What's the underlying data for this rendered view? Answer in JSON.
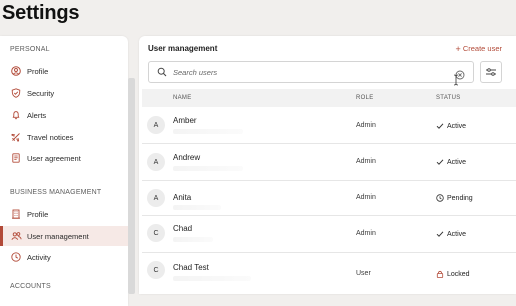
{
  "page": {
    "title": "Settings"
  },
  "sidebar": {
    "personal_heading": "PERSONAL",
    "personal_items": [
      {
        "label": "Profile",
        "icon": "user-circle-icon"
      },
      {
        "label": "Security",
        "icon": "shield-icon"
      },
      {
        "label": "Alerts",
        "icon": "bell-icon"
      },
      {
        "label": "Travel notices",
        "icon": "plane-icon"
      },
      {
        "label": "User agreement",
        "icon": "document-icon"
      }
    ],
    "business_heading": "BUSINESS MANAGEMENT",
    "business_items": [
      {
        "label": "Profile",
        "icon": "building-icon"
      },
      {
        "label": "User management",
        "icon": "users-icon",
        "active": true
      },
      {
        "label": "Activity",
        "icon": "clock-icon"
      }
    ],
    "accounts_heading": "ACCOUNTS"
  },
  "main": {
    "title": "User management",
    "create_user_label": "Create user",
    "search": {
      "placeholder": "Search users",
      "value": ""
    },
    "table": {
      "headers": {
        "name": "NAME",
        "role": "ROLE",
        "status": "STATUS"
      },
      "rows": [
        {
          "initial": "A",
          "name": "Amber",
          "role": "Admin",
          "status": "Active",
          "status_icon": "check-icon"
        },
        {
          "initial": "A",
          "name": "Andrew",
          "role": "Admin",
          "status": "Active",
          "status_icon": "check-icon"
        },
        {
          "initial": "A",
          "name": "Anita",
          "role": "Admin",
          "status": "Pending",
          "status_icon": "clock-icon"
        },
        {
          "initial": "C",
          "name": "Chad",
          "role": "Admin",
          "status": "Active",
          "status_icon": "check-icon"
        },
        {
          "initial": "C",
          "name": "Chad Test",
          "role": "User",
          "status": "Locked",
          "status_icon": "lock-icon"
        }
      ]
    }
  },
  "colors": {
    "accent": "#b24a38",
    "active_bg": "#f6e9e6",
    "page_bg": "#f1efed",
    "header_bg": "#f2f2f2"
  }
}
